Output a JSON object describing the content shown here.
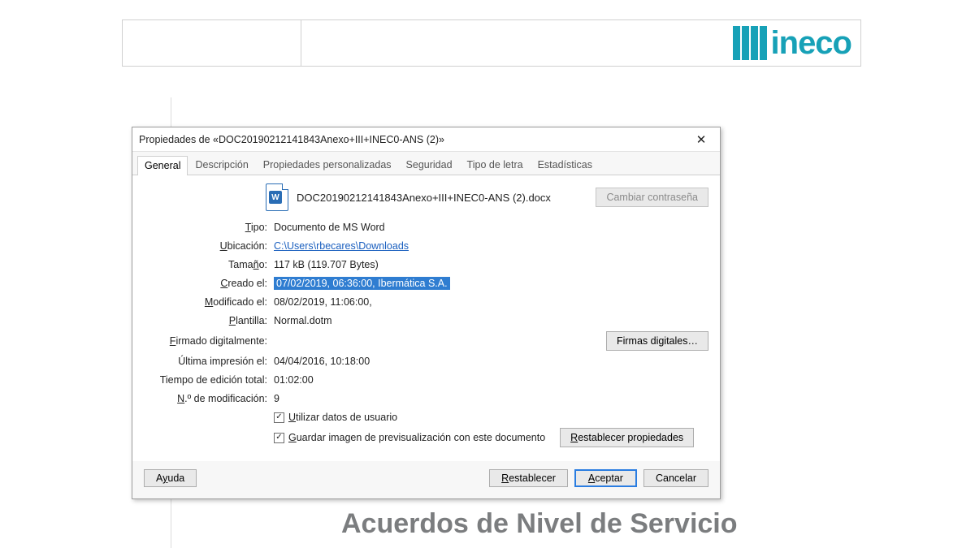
{
  "background": {
    "logo_text": "ineco",
    "title": "Acuerdos de Nivel de Servicio"
  },
  "dialog": {
    "title": "Propiedades de «DOC20190212141843Anexo+III+INEC0-ANS (2)»",
    "close_glyph": "✕",
    "tabs": {
      "general": "General",
      "desc": "Descripción",
      "custom": "Propiedades personalizadas",
      "security": "Seguridad",
      "font": "Tipo de letra",
      "stats": "Estadísticas"
    },
    "filename": "DOC20190212141843Anexo+III+INEC0-ANS (2).docx",
    "btn_change_password": "Cambiar contraseña",
    "labels": {
      "type": "Tipo:",
      "location": "Ubicación:",
      "size": "Tamaño:",
      "created": "Creado el:",
      "modified": "Modificado el:",
      "template": "Plantilla:",
      "signed": "Firmado digitalmente:",
      "lastprint": "Última impresión el:",
      "edit_time": "Tiempo de edición total:",
      "revision": "N.º de modificación:"
    },
    "values": {
      "type": "Documento de MS Word",
      "location": "C:\\Users\\rbecares\\Downloads",
      "size": "117 kB (119.707 Bytes)",
      "created": "07/02/2019, 06:36:00, Ibermática S.A.",
      "modified": "08/02/2019, 11:06:00,",
      "template": "Normal.dotm",
      "signed": "",
      "lastprint": "04/04/2016, 10:18:00",
      "edit_time": "01:02:00",
      "revision": "9"
    },
    "btn_digital_sign": "Firmas digitales…",
    "btn_reset_props": "Restablecer propiedades",
    "chk_userdata": "Utilizar datos de usuario",
    "chk_preview": "Guardar imagen de previsualización con este documento",
    "footer": {
      "help": "Ayuda",
      "reset": "Restablecer",
      "ok": "Aceptar",
      "cancel": "Cancelar"
    }
  }
}
